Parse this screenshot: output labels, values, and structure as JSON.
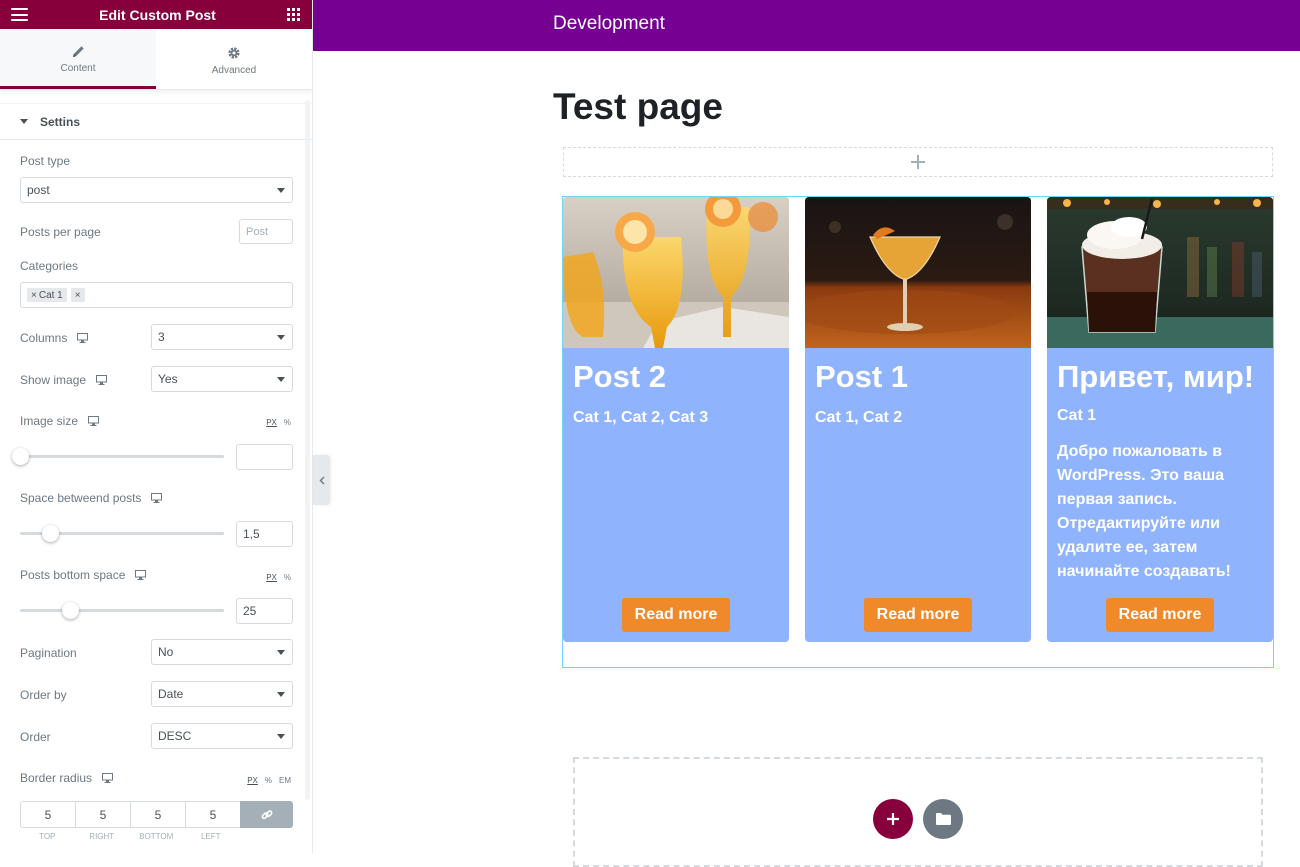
{
  "panel": {
    "title": "Edit Custom Post",
    "colors": {
      "brand": "#87003c"
    },
    "tabs": [
      {
        "label": "Content",
        "icon": "pencil-icon",
        "active": true
      },
      {
        "label": "Advanced",
        "icon": "gear-icon",
        "active": false
      }
    ],
    "section": "Settins",
    "post_type": {
      "label": "Post type",
      "value": "post"
    },
    "posts_per_page": {
      "label": "Posts per page",
      "placeholder": "Post"
    },
    "categories": {
      "label": "Categories",
      "tags": [
        "Cat 1",
        ""
      ]
    },
    "columns": {
      "label": "Columns",
      "value": "3"
    },
    "show_image": {
      "label": "Show image",
      "value": "Yes"
    },
    "image_size": {
      "label": "Image size",
      "value": "",
      "units": [
        "PX",
        "%"
      ]
    },
    "space_between": {
      "label": "Space betweend posts",
      "value": "1,5"
    },
    "posts_bottom": {
      "label": "Posts bottom space",
      "value": "25",
      "units": [
        "PX",
        "%"
      ]
    },
    "pagination": {
      "label": "Pagination",
      "value": "No"
    },
    "order_by": {
      "label": "Order by",
      "value": "Date"
    },
    "order": {
      "label": "Order",
      "value": "DESC"
    },
    "border_radius": {
      "label": "Border radius",
      "units": [
        "PX",
        "%",
        "EM"
      ],
      "values": [
        "5",
        "5",
        "5",
        "5"
      ],
      "sides": [
        "TOP",
        "RIGHT",
        "BOTTOM",
        "LEFT"
      ]
    }
  },
  "site": {
    "title": "Development",
    "page_title": "Test page",
    "colors": {
      "header": "#750091",
      "card": "#8fb3fc",
      "button": "#f0892a"
    }
  },
  "posts": [
    {
      "title": "Post 2",
      "cats": "Cat 1,  Cat 2,  Cat 3",
      "excerpt": "",
      "button": "Read more"
    },
    {
      "title": "Post 1",
      "cats": "Cat 1,  Cat 2",
      "excerpt": "",
      "button": "Read more"
    },
    {
      "title": "Привет, мир!",
      "cats": "Cat 1",
      "excerpt": "Добро пожаловать в WordPress. Это ваша первая запись. Отредактируйте или удалите ее, затем начинайте создавать!",
      "button": "Read more"
    }
  ]
}
